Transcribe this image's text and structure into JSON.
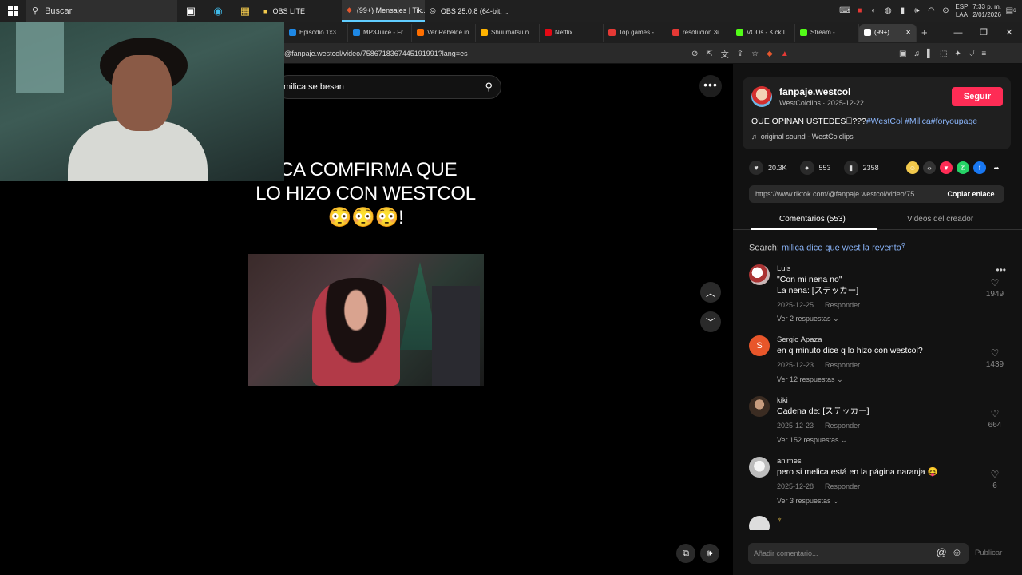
{
  "taskbar": {
    "search_placeholder": "Buscar",
    "tasks": [
      {
        "label": "OBS LITE",
        "color": "#f2c94c",
        "active": false
      },
      {
        "label": "(99+) Mensajes | Tik...",
        "color": "#e4572e",
        "active": true
      },
      {
        "label": "OBS 25.0.8 (64-bit, ...",
        "color": "#ffffff",
        "active": false
      }
    ],
    "lang": "ESP",
    "lang2": "LAA",
    "time": "7:33 p. m.",
    "date": "2/01/2026",
    "notif_count": "6"
  },
  "browser": {
    "tabs": [
      {
        "label": "Episodio 1x3",
        "color": "#1e88e5"
      },
      {
        "label": "MP3Juice - Fr",
        "color": "#1e88e5"
      },
      {
        "label": "Ver Rebelde in",
        "color": "#ff6f00"
      },
      {
        "label": "Shuumatsu n",
        "color": "#ffb300"
      },
      {
        "label": "Netflix",
        "color": "#e50914"
      },
      {
        "label": "Top games -",
        "color": "#e53935"
      },
      {
        "label": "resolucion 3i",
        "color": "#e53935"
      },
      {
        "label": "VODs - Kick L",
        "color": "#53fc18"
      },
      {
        "label": "Stream - ",
        "color": "#53fc18"
      },
      {
        "label": "(99+)",
        "color": "#ffffff"
      }
    ],
    "url": "@fanpaje.westcol/video/7586718367445191991?lang=es"
  },
  "video": {
    "search_text": "milica se besan",
    "title_line1": "ICA COMFIRMA QUE",
    "title_line2": "LO HIZO CON WESTCOL",
    "title_line3": "😳😳😳!"
  },
  "post": {
    "author": "fanpaje.westcol",
    "sub": "WestColclips · 2025-12-22",
    "follow_label": "Seguir",
    "desc": "QUE OPINAN USTEDES\u0000???",
    "tags": "#WestCol #Milica#foryoupage",
    "sound": "original sound - WestColclips",
    "likes": "20.3K",
    "comments": "553",
    "saves": "2358",
    "link": "https://www.tiktok.com/@fanpaje.westcol/video/75...",
    "copy_label": "Copiar enlace",
    "tab_comments": "Comentarios (553)",
    "tab_videos": "Videos del creador",
    "search_label": "Search:",
    "search_query": "milica dice que west la revento"
  },
  "comments": [
    {
      "user": "Luis",
      "text": "\"Con mi nena no\"\nLa nena: [ステッカー]",
      "date": "2025-12-25",
      "reply": "Responder",
      "more": "Ver 2 respuestas",
      "likes": "1949",
      "avatar_color": "#c9b6b6",
      "initial": ""
    },
    {
      "user": "Sergio Apaza",
      "text": "en q minuto dice q lo hizo con westcol?",
      "date": "2025-12-23",
      "reply": "Responder",
      "more": "Ver 12 respuestas",
      "likes": "1439",
      "avatar_color": "#e8562a",
      "initial": "S"
    },
    {
      "user": "kiki",
      "text": "Cadena de: [ステッカー]",
      "date": "2025-12-23",
      "reply": "Responder",
      "more": "Ver 152 respuestas",
      "likes": "664",
      "avatar_color": "#6b5a4a",
      "initial": ""
    },
    {
      "user": "animes",
      "text": "pero si melica está en la página naranja 😝",
      "date": "2025-12-28",
      "reply": "Responder",
      "more": "Ver 3 respuestas",
      "likes": "6",
      "avatar_color": "#d8d8d8",
      "initial": ""
    }
  ],
  "next_comment_user": "♆",
  "input": {
    "placeholder": "Añadir comentario...",
    "publish_label": "Publicar"
  }
}
